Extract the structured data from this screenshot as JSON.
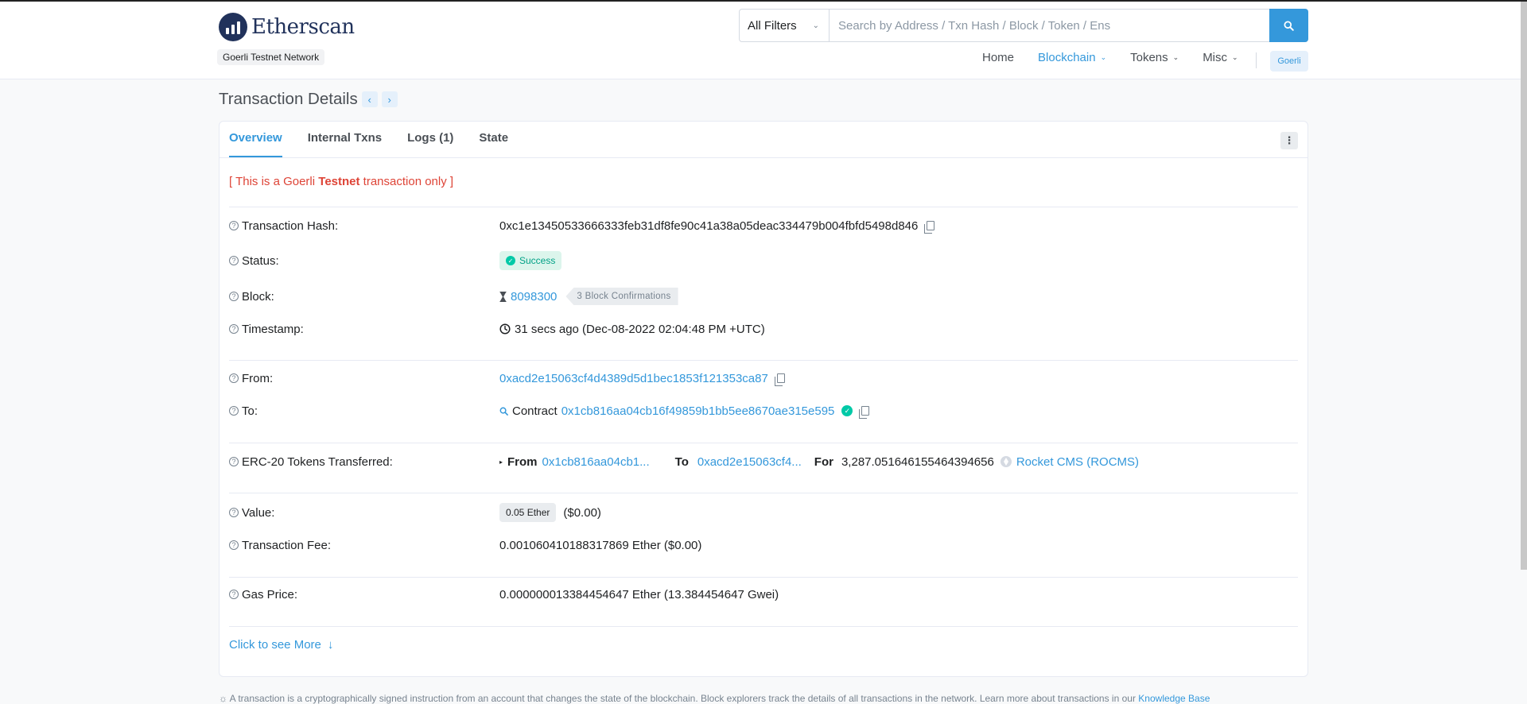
{
  "header": {
    "logo_text": "Etherscan",
    "network_badge": "Goerli Testnet Network",
    "search": {
      "filter_label": "All Filters",
      "placeholder": "Search by Address / Txn Hash / Block / Token / Ens"
    },
    "nav": [
      {
        "label": "Home",
        "active": false
      },
      {
        "label": "Blockchain",
        "active": true
      },
      {
        "label": "Tokens",
        "active": false
      },
      {
        "label": "Misc",
        "active": false
      }
    ],
    "network_button": "Goerli"
  },
  "page": {
    "title": "Transaction Details"
  },
  "tabs": [
    "Overview",
    "Internal Txns",
    "Logs (1)",
    "State"
  ],
  "notice": {
    "prefix": "[ This is a Goerli ",
    "bold": "Testnet",
    "suffix": " transaction only ]"
  },
  "details": {
    "hash_label": "Transaction Hash:",
    "hash_value": "0xc1e13450533666333feb31df8fe90c41a38a05deac334479b004fbfd5498d846",
    "status_label": "Status:",
    "status_value": "Success",
    "block_label": "Block:",
    "block_value": "8098300",
    "block_confirmations": "3 Block Confirmations",
    "timestamp_label": "Timestamp:",
    "timestamp_value": "31 secs ago (Dec-08-2022 02:04:48 PM +UTC)",
    "from_label": "From:",
    "from_value": "0xacd2e15063cf4d4389d5d1bec1853f121353ca87",
    "to_label": "To:",
    "to_prefix": "Contract",
    "to_value": "0x1cb816aa04cb16f49859b1bb5ee8670ae315e595",
    "erc20_label": "ERC-20 Tokens Transferred:",
    "erc20": {
      "from_word": "From",
      "from_addr": "0x1cb816aa04cb1...",
      "to_word": "To",
      "to_addr": "0xacd2e15063cf4...",
      "for_word": "For",
      "amount": "3,287.051646155464394656",
      "token": "Rocket CMS (ROCMS)"
    },
    "value_label": "Value:",
    "value_badge": "0.05 Ether",
    "value_usd": "($0.00)",
    "fee_label": "Transaction Fee:",
    "fee_value": "0.001060410188317869 Ether ($0.00)",
    "gas_label": "Gas Price:",
    "gas_value": "0.000000013384454647 Ether (13.384454647 Gwei)"
  },
  "see_more": "Click to see More",
  "footer_note": "A transaction is a cryptographically signed instruction from an account that changes the state of the blockchain. Block explorers track the details of all transactions in the network. Learn more about transactions in our",
  "footer_link": "Knowledge Base",
  "colors": {
    "accent": "#3498db",
    "success": "#00c9a7",
    "danger": "#de4437",
    "brand": "#21325b"
  }
}
